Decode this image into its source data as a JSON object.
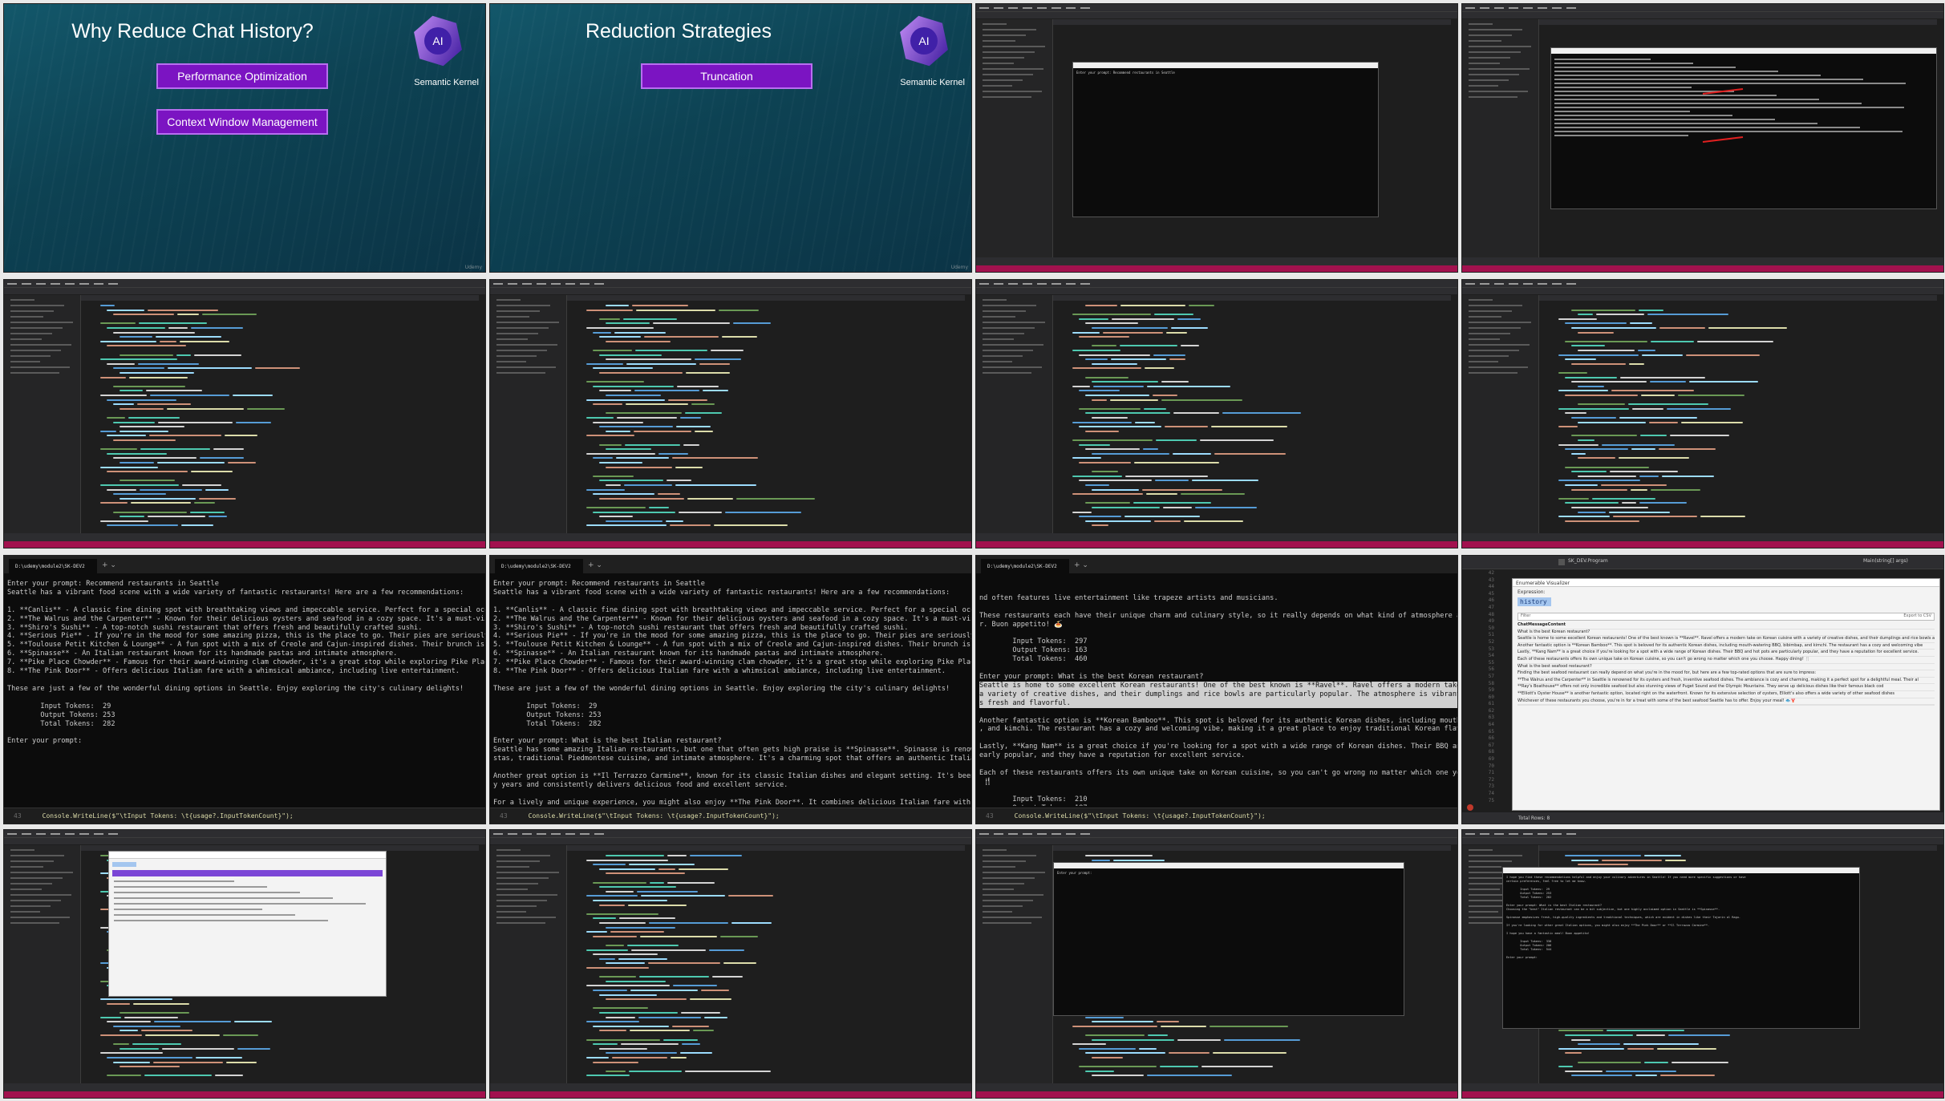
{
  "slides": [
    {
      "title": "Why Reduce Chat History?",
      "buttons": [
        "Performance Optimization",
        "Context Window Management"
      ],
      "logo_text": "AI",
      "caption": "Semantic Kernel",
      "watermark": "Udemy"
    },
    {
      "title": "Reduction Strategies",
      "buttons": [
        "Truncation"
      ],
      "logo_text": "AI",
      "caption": "Semantic Kernel",
      "watermark": "Udemy"
    }
  ],
  "console_prompt_1": "Enter your prompt: Recommend restaurants in Seattle",
  "console_prompt_2": "Enter your prompt:",
  "terminals": [
    {
      "tab_title": "D:\\udemy\\module2\\SK-DEV2",
      "lines": [
        "Enter your prompt: Recommend restaurants in Seattle",
        "Seattle has a vibrant food scene with a wide variety of fantastic restaurants! Here are a few recommendations:",
        "",
        "1. **Canlis** - A classic fine dining spot with breathtaking views and impeccable service. Perfect for a special occasion!",
        "2. **The Walrus and the Carpenter** - Known for their delicious oysters and seafood in a cozy space. It's a must-visit for",
        "3. **Shiro's Sushi** - A top-notch sushi restaurant that offers fresh and beautifully crafted sushi.",
        "4. **Serious Pie** - If you're in the mood for some amazing pizza, this is the place to go. Their pies are seriously good",
        "5. **Toulouse Petit Kitchen & Lounge** - A fun spot with a mix of Creole and Cajun-inspired dishes. Their brunch is partic",
        "6. **Spinasse** - An Italian restaurant known for its handmade pastas and intimate atmosphere.",
        "7. **Pike Place Chowder** - Famous for their award-winning clam chowder, it's a great stop while exploring Pike Place Mark",
        "8. **The Pink Door** - Offers delicious Italian fare with a whimsical ambiance, including live entertainment.",
        "",
        "These are just a few of the wonderful dining options in Seattle. Enjoy exploring the city's culinary delights!",
        "",
        "        Input Tokens:  29",
        "        Output Tokens: 253",
        "        Total Tokens:  282",
        "",
        "Enter your prompt:"
      ],
      "footer_line": "43",
      "footer_code": "Console.WriteLine($\"\\tInput Tokens: \\t{usage?.InputTokenCount}\");",
      "watermark": "Udemy"
    },
    {
      "tab_title": "D:\\udemy\\module2\\SK-DEV2",
      "lines": [
        "Enter your prompt: Recommend restaurants in Seattle",
        "Seattle has a vibrant food scene with a wide variety of fantastic restaurants! Here are a few recommendations:",
        "",
        "1. **Canlis** - A classic fine dining spot with breathtaking views and impeccable service. Perfect for a special occasion!",
        "2. **The Walrus and the Carpenter** - Known for their delicious oysters and seafood in a cozy space. It's a must-visit for",
        "3. **Shiro's Sushi** - A top-notch sushi restaurant that offers fresh and beautifully crafted sushi.",
        "4. **Serious Pie** - If you're in the mood for some amazing pizza, this is the place to go. Their pies are seriously good",
        "5. **Toulouse Petit Kitchen & Lounge** - A fun spot with a mix of Creole and Cajun-inspired dishes. Their brunch is partic",
        "6. **Spinasse** - An Italian restaurant known for its handmade pastas and intimate atmosphere.",
        "7. **Pike Place Chowder** - Famous for their award-winning clam chowder, it's a great stop while exploring Pike Place Mark",
        "8. **The Pink Door** - Offers delicious Italian fare with a whimsical ambiance, including live entertainment.",
        "",
        "These are just a few of the wonderful dining options in Seattle. Enjoy exploring the city's culinary delights!",
        "",
        "        Input Tokens:  29",
        "        Output Tokens: 253",
        "        Total Tokens:  282",
        "",
        "Enter your prompt: What is the best Italian restaurant?",
        "Seattle has some amazing Italian restaurants, but one that often gets high praise is **Spinasse**. Spinasse is renowned fo",
        "stas, traditional Piedmontese cuisine, and intimate atmosphere. It's a charming spot that offers an authentic Italian din",
        "",
        "Another great option is **Il Terrazzo Carmine**, known for its classic Italian dishes and elegant setting. It's been a b",
        "y years and consistently delivers delicious food and excellent service.",
        "",
        "For a lively and unique experience, you might also enjoy **The Pink Door**. It combines delicious Italian fare with a whim",
        "nd often features live entertainment like trapeze artists and musicians."
      ],
      "footer_line": "43",
      "footer_code": "Console.WriteLine($\"\\tInput Tokens: \\t{usage?.InputTokenCount}\");",
      "watermark": "Udemy"
    },
    {
      "tab_title": "D:\\udemy\\module2\\SK-DEV2",
      "lines": [
        "nd often features live entertainment like trapeze artists and musicians.",
        "",
        "These restaurants each have their unique charm and culinary style, so it really depends on what kind of atmosphere and men",
        "r. Buon appetito! 🍝",
        "",
        "        Input Tokens:  297",
        "        Output Tokens: 163",
        "        Total Tokens:  460",
        "",
        "Enter your prompt: What is the best Korean restaurant?"
      ],
      "selected_lines": [
        "Seattle is home to some excellent Korean restaurants! One of the best known is **Ravel**. Ravel offers a modern take on Ko",
        "a variety of creative dishes, and their dumplings and rice bowls are particularly popular. The atmosphere is vibrant and",
        "s fresh and flavorful."
      ],
      "lines_after": [
        "",
        "Another fantastic option is **Korean Bamboo**. This spot is beloved for its authentic Korean dishes, including mouth-water",
        ", and kimchi. The restaurant has a cozy and welcoming vibe, making it a great place to enjoy traditional Korean flavors.",
        "",
        "Lastly, **Kang Nam** is a great choice if you're looking for a spot with a wide range of Korean dishes. Their BBQ and hot",
        "early popular, and they have a reputation for excellent service.",
        "",
        "Each of these restaurants offers its own unique take on Korean cuisine, so you can't go wrong no matter which one you choo",
        " 🍴",
        "",
        "        Input Tokens:  210",
        "        Output Tokens: 187",
        "        Total Tokens:  397",
        "",
        "Enter your prompt: "
      ],
      "footer_line": "43",
      "footer_code": "Console.WriteLine($\"\\tInput Tokens: \\t{usage?.InputTokenCount}\");",
      "watermark": "Udemy"
    }
  ],
  "visualizer": {
    "title": "Enumerable Visualizer",
    "expression_label": "Expression:",
    "expression": "history",
    "filter_label": "Filter",
    "export_label": "Export to CSV",
    "column": "ChatMessageContent",
    "rows": [
      "What is the best Korean restaurant?",
      "Seattle is home to some excellent Korean restaurants! One of the best known is **Ravel**. Ravel offers a modern take on Korean cuisine with a variety of creative dishes, and their dumplings and rice bowls are part",
      "Another fantastic option is **Korean Bamboo**. This spot is beloved for its authentic Korean dishes, including mouth-watering BBQ, bibimbap, and kimchi. The restaurant has a cozy and welcoming vibe",
      "Lastly, **Kang Nam** is a great choice if you're looking for a spot with a wide range of Korean dishes. Their BBQ and hot pots are particularly popular, and they have a reputation for excellent service.",
      "Each of these restaurants offers its own unique take on Korean cuisine, so you can't go wrong no matter which one you choose. Happy dining! 🍴",
      "What is the best seafood restaurant?",
      "Finding the best seafood restaurant can really depend on what you're in the mood for, but here are a few top-rated options that are sure to impress:",
      "**The Walrus and the Carpenter** in Seattle is renowned for its oysters and fresh, inventive seafood dishes. The ambiance is cozy and charming, making it a perfect spot for a delightful meal. Their al",
      "**Ray's Boathouse** offers not only incredible seafood but also stunning views of Puget Sound and the Olympic Mountains. They serve up delicious dishes like their famous black cod",
      "**Elliott's Oyster House** is another fantastic option, located right on the waterfront. Known for its extensive selection of oysters, Elliott's also offers a wide variety of other seafood dishes",
      "Whichever of these restaurants you choose, you're in for a treat with some of the best seafood Seattle has to offer. Enjoy your meal! 🐟🦞"
    ],
    "status": "Total Rows: 8",
    "line_numbers": [
      "42",
      "43",
      "44",
      "45",
      "46",
      "47",
      "48",
      "49",
      "50",
      "51",
      "52",
      "53",
      "54",
      "55",
      "56",
      "57",
      "58",
      "59",
      "60",
      "61",
      "62",
      "63",
      "64",
      "65",
      "66",
      "67",
      "68",
      "69",
      "70",
      "71",
      "72",
      "73",
      "74",
      "75"
    ],
    "breadcrumb": "SK_DEV.Program",
    "method": "Main(string[] args)"
  },
  "final_console": {
    "lines": [
      "I hope you find these recommendations helpful and enjoy your culinary adventures in Seattle! If you need more specific suggestions or have",
      "certain preferences, feel free to let me know.",
      "",
      "        Input Tokens:  29",
      "        Output Tokens: 253",
      "        Total Tokens:  282",
      "",
      "Enter your prompt: What is the best Italian restaurant?",
      "Choosing the \"best\" Italian restaurant can be a bit subjective, but one highly acclaimed option in Seattle is **Spinasse**.",
      "",
      "Spinasse emphasizes fresh, high-quality ingredients and traditional techniques, which are evident in dishes like their Tajarin al Ragu.",
      "",
      "If you're looking for other great Italian options, you might also enjoy **The Pink Door** or **Il Terrazzo Carmine**.",
      "",
      "I hope you have a fantastic meal! Buon appetito!",
      "",
      "        Input Tokens:  338",
      "        Output Tokens: 206",
      "        Total Tokens:  544",
      "",
      "Enter your prompt: "
    ]
  },
  "colors": {
    "slide_button": "#7b14c2",
    "ide_status": "#a2114e",
    "terminal_bg": "#0c0c0c",
    "selection": "#cfcfcf",
    "cursor": "#3ce63c"
  }
}
